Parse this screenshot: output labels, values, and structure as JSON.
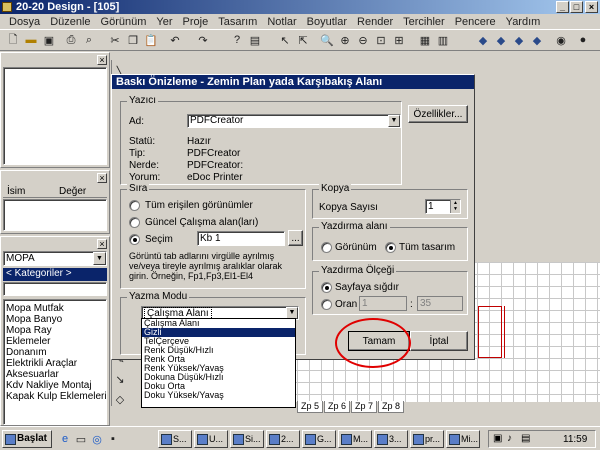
{
  "window": {
    "title": "20-20 Design - [105]"
  },
  "menu": [
    "Dosya",
    "Düzenle",
    "Görünüm",
    "Yer",
    "Proje",
    "Tasarım",
    "Notlar",
    "Boyutlar",
    "Render",
    "Tercihler",
    "Pencere",
    "Yardım"
  ],
  "left_panel": {
    "col_name": "İsim",
    "col_value": "Değer",
    "catalog_select": "MOPA",
    "category_select": "< Kategoriler >",
    "catalog_items": [
      "Mopa Mutfak",
      "Mopa Banyo",
      "Mopa Ray",
      "Eklemeler",
      "Donanım",
      "Elektrikli Araçlar",
      "Aksesuarlar",
      "Kdv Nakliye Montaj",
      "Kapak Kulp Eklemeleri"
    ]
  },
  "dialog": {
    "title": "Baskı Önizleme - Zemin Plan yada Karşıbakış Alanı",
    "printer": {
      "group": "Yazıcı",
      "name_label": "Ad:",
      "name_value": "PDFCreator",
      "properties_button": "Özellikler...",
      "status_label": "Statü:",
      "status_value": "Hazır",
      "type_label": "Tip:",
      "type_value": "PDFCreator",
      "where_label": "Nerde:",
      "where_value": "PDFCreator:",
      "comment_label": "Yorum:",
      "comment_value": "eDoc Printer"
    },
    "order": {
      "group": "Sıra",
      "opt_all": "Tüm erişilen görünümler",
      "opt_current": "Güncel Çalışma alan(ları)",
      "opt_selection": "Seçim",
      "selection_value": "Kb 1",
      "browse": "...",
      "help": "Görüntü tab adlarını virgülle ayrılmış ve/veya tireyle ayrılmış aralıklar olarak girin. Örneğin, Fp1,Fp3,El1-El4"
    },
    "copies": {
      "group": "Kopya",
      "label": "Kopya Sayısı",
      "value": "1"
    },
    "print_area": {
      "group": "Yazdırma alanı",
      "opt_view": "Görünüm",
      "opt_all": "Tüm tasarım"
    },
    "scale": {
      "group": "Yazdırma Ölçeği",
      "opt_fit": "Sayfaya sığdır",
      "opt_ratio": "Oran",
      "ratio_value": "1",
      "ratio_value2": "35"
    },
    "write_mode": {
      "group": "Yazma Modu",
      "selected": "Çalışma Alanı",
      "options": [
        "Çalışma Alanı",
        "Gizli",
        "TelÇerçeve",
        "Renk Düşük/Hızlı",
        "Renk Orta",
        "Renk Yüksek/Yavaş",
        "Dokuna Düşük/Hızlı",
        "Doku Orta",
        "Doku Yüksek/Yavaş"
      ],
      "highlighted_index": 1
    },
    "ok_button": "Tamam",
    "cancel_button": "İptal"
  },
  "tabs": [
    "Zp 5",
    "Zp 6",
    "Zp 7",
    "Zp 8"
  ],
  "taskbar": {
    "start": "Başlat",
    "tasks": [
      "S...",
      "U...",
      "Si...",
      "2...",
      "G...",
      "M...",
      "3...",
      "pr...",
      "Mi..."
    ],
    "clock": "11:59"
  },
  "colors": {
    "titlebar": "#0a246a",
    "highlight": "#0a246a",
    "annotation": "#e00000"
  }
}
